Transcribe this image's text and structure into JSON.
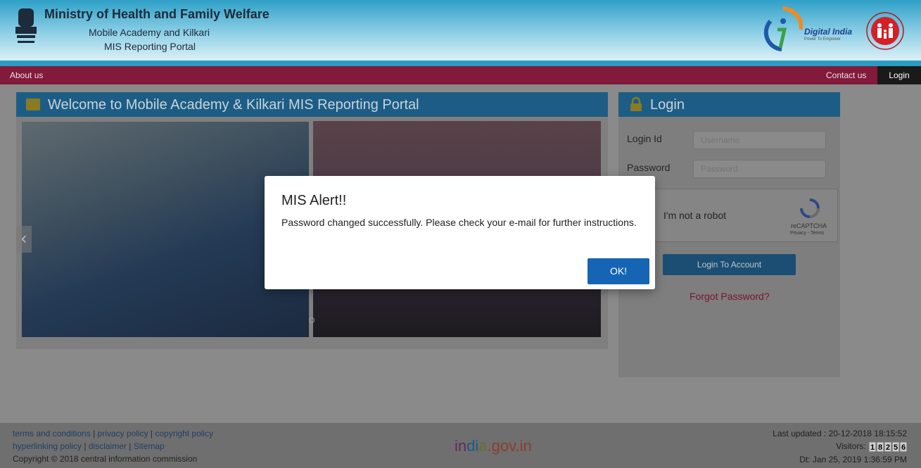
{
  "header": {
    "ministry": "Ministry of Health and Family Welfare",
    "subtitle_1": "Mobile Academy and Kilkari",
    "subtitle_2": "MIS Reporting Portal",
    "digital_india": "Digital India",
    "digital_india_tagline": "Power To Empower",
    "emblem_icon": "national-emblem-icon",
    "nhm_logo": "national-health-mission-logo"
  },
  "nav": {
    "about": "About us",
    "contact": "Contact us",
    "login": "Login"
  },
  "welcome": {
    "title": "Welcome to Mobile Academy & Kilkari MIS Reporting Portal",
    "prev_arrow": "‹"
  },
  "login": {
    "title": "Login",
    "id_label": "Login Id",
    "username_placeholder": "Username",
    "password_label": "Password",
    "password_placeholder": "Password",
    "captcha_text": "I'm not a robot",
    "captcha_brand": "reCAPTCHA",
    "captcha_links": "Privacy - Terms",
    "button": "Login To Account",
    "forgot": "Forgot Password?"
  },
  "footer": {
    "links": {
      "terms": "terms and conditions",
      "privacy": "privacy policy",
      "copyright_policy": "copyright policy",
      "hyperlinking": "hyperlinking policy",
      "disclaimer": "disclaimer",
      "sitemap": "Sitemap"
    },
    "separator": "|",
    "copyright": "Copyright © 2018 central information commission",
    "india_gov": {
      "p1": "in",
      "p2": "di",
      "p3": "a",
      "p4": ".gov.in"
    },
    "last_updated": "Last updated : 20-12-2018 18:15:52",
    "visitors_label": "Visitors:",
    "visitor_digits": [
      "1",
      "8",
      "2",
      "5",
      "6"
    ],
    "date": "Dt: Jan 25, 2019 1:36:59 PM"
  },
  "modal": {
    "title": "MIS Alert!!",
    "message": "Password changed successfully. Please check your e-mail for further instructions.",
    "ok": "OK!"
  },
  "colors": {
    "nav_bg": "#821b3b",
    "panel_head": "#1d5d85",
    "ok_button": "#1565b4",
    "forgot_link": "#7d1330"
  }
}
